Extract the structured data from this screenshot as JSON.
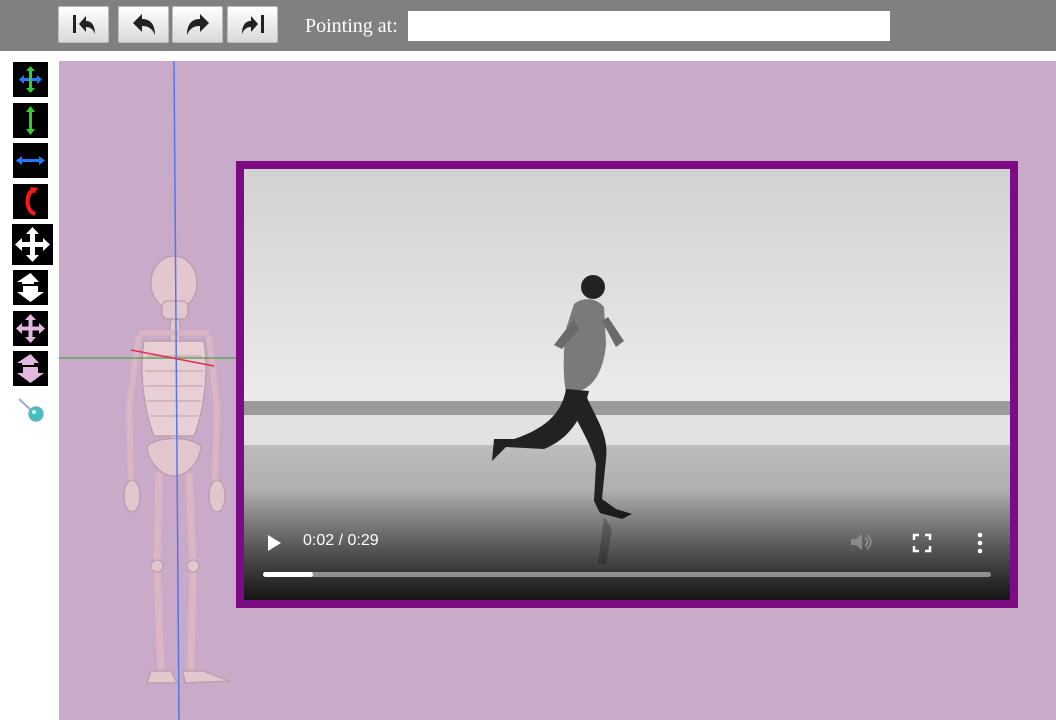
{
  "toolbar": {
    "buttons": [
      {
        "name": "undo-all-icon"
      },
      {
        "name": "undo-icon"
      },
      {
        "name": "redo-icon"
      },
      {
        "name": "redo-all-icon"
      }
    ],
    "pointing_label": "Pointing at:",
    "pointing_value": ""
  },
  "tools": [
    {
      "name": "move-xy-icon",
      "colors": [
        "#33cc33",
        "#1e7bff"
      ]
    },
    {
      "name": "move-vertical-icon",
      "colors": [
        "#33cc33"
      ]
    },
    {
      "name": "move-horizontal-icon",
      "colors": [
        "#1e7bff"
      ]
    },
    {
      "name": "rotate-icon",
      "colors": [
        "#ff1a1a"
      ]
    },
    {
      "name": "move-all-white-icon",
      "colors": [
        "#ffffff"
      ]
    },
    {
      "name": "move-depth-white-icon",
      "colors": [
        "#ffffff"
      ]
    },
    {
      "name": "move-all-pink-icon",
      "colors": [
        "#e0b8e0"
      ]
    },
    {
      "name": "move-depth-pink-icon",
      "colors": [
        "#e0b8e0"
      ]
    },
    {
      "name": "pin-icon",
      "colors": [
        "#40c0c0"
      ]
    }
  ],
  "scene": {
    "background": "#c9abc9",
    "model": "skeleton"
  },
  "video": {
    "border_color": "#7d0b83",
    "time": "0:02 / 0:29",
    "progress": 0.069,
    "controls": [
      "play-icon",
      "volume-icon",
      "fullscreen-icon",
      "more-options-icon"
    ]
  }
}
